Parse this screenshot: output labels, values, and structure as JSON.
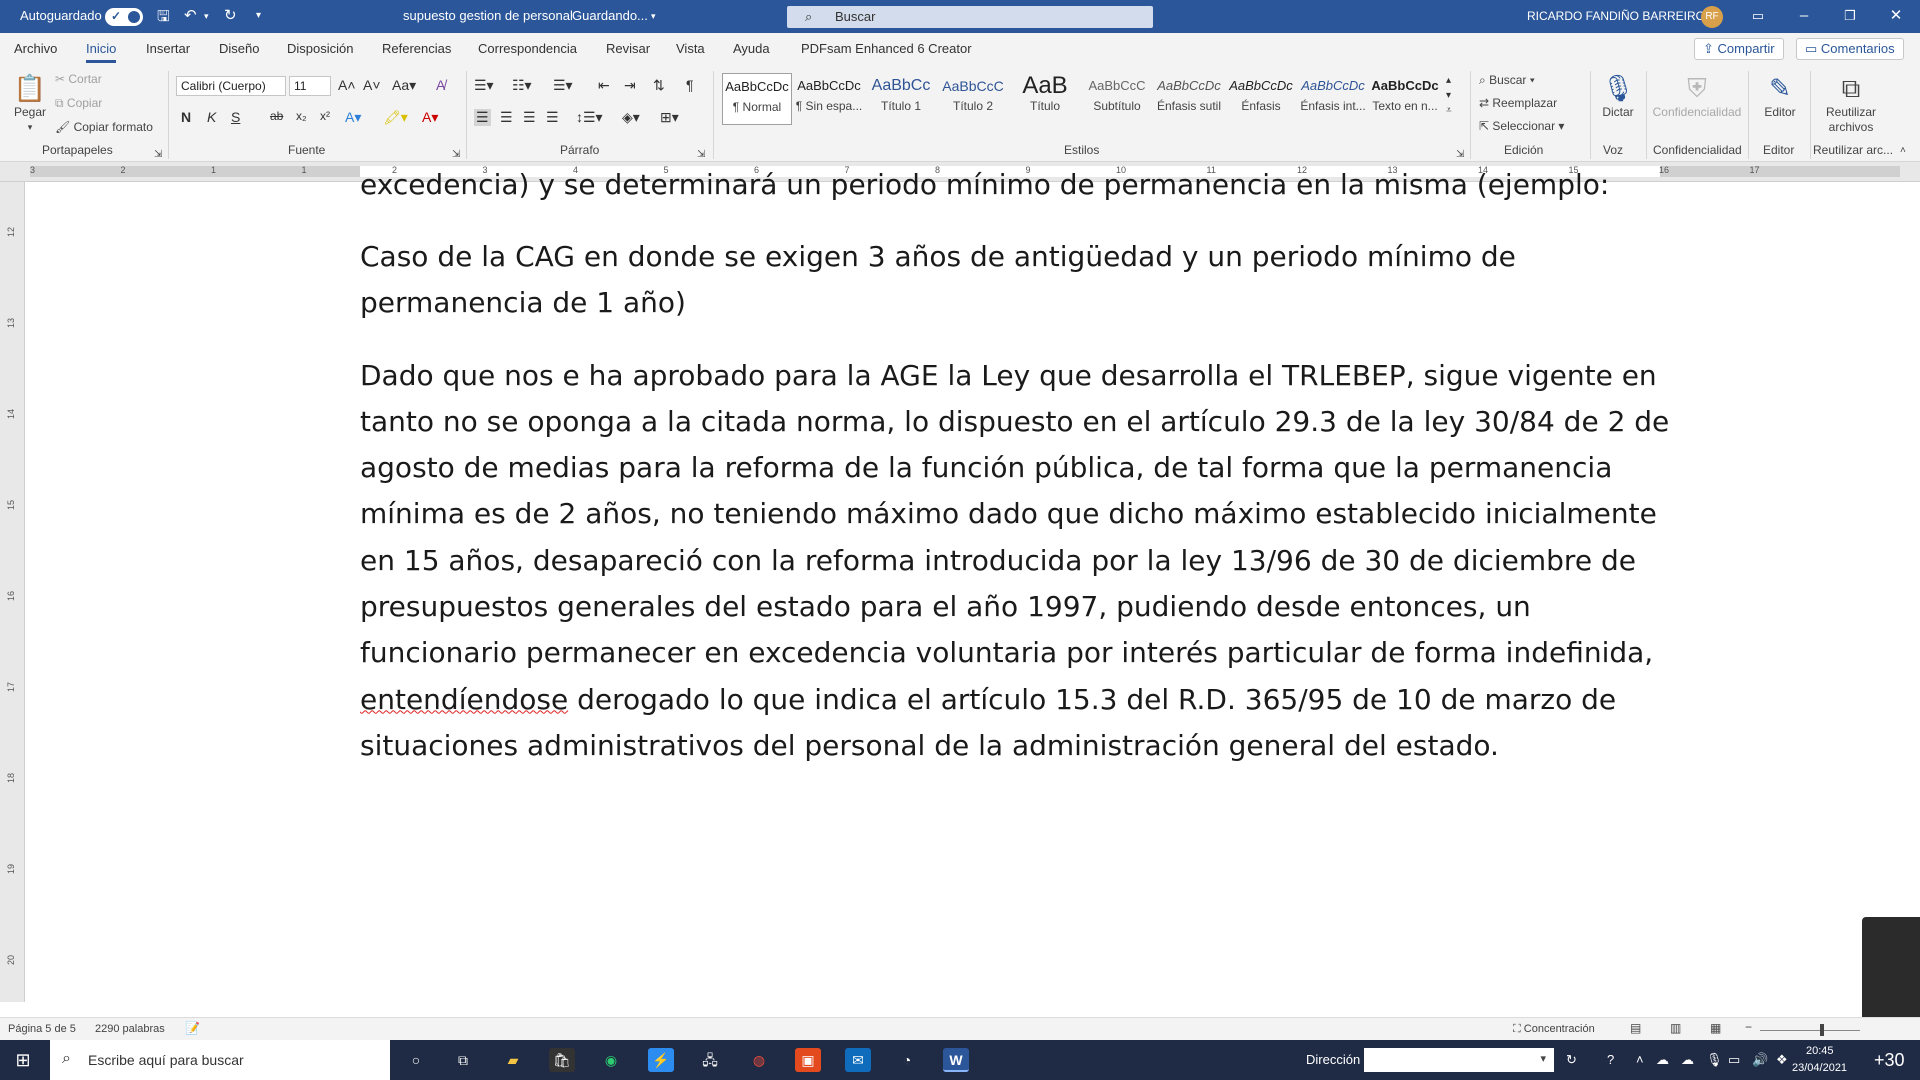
{
  "titlebar": {
    "autosave_label": "Autoguardado",
    "doc_title": "supuesto gestion de personal",
    "save_state": "Guardando...",
    "search_placeholder": "Buscar",
    "user_name": "RICARDO FANDIÑO BARREIRO",
    "user_initials": "RF"
  },
  "tabs": [
    "Archivo",
    "Inicio",
    "Insertar",
    "Diseño",
    "Disposición",
    "Referencias",
    "Correspondencia",
    "Revisar",
    "Vista",
    "Ayuda",
    "PDFsam Enhanced 6 Creator"
  ],
  "active_tab": "Inicio",
  "share_label": "Compartir",
  "comments_label": "Comentarios",
  "ribbon": {
    "clipboard": {
      "paste": "Pegar",
      "cut": "Cortar",
      "copy": "Copiar",
      "format_painter": "Copiar formato",
      "group": "Portapapeles"
    },
    "font": {
      "family": "Calibri (Cuerpo)",
      "size": "11",
      "group": "Fuente",
      "bold": "N",
      "italic": "K",
      "underline": "S"
    },
    "paragraph": {
      "group": "Párrafo"
    },
    "styles": {
      "group": "Estilos",
      "items": [
        {
          "preview": "AaBbCcDc",
          "label": "¶ Normal"
        },
        {
          "preview": "AaBbCcDc",
          "label": "¶ Sin espa..."
        },
        {
          "preview": "AaBbCc",
          "label": "Título 1"
        },
        {
          "preview": "AaBbCcC",
          "label": "Título 2"
        },
        {
          "preview": "AaB",
          "label": "Título"
        },
        {
          "preview": "AaBbCcC",
          "label": "Subtítulo"
        },
        {
          "preview": "AaBbCcDc",
          "label": "Énfasis sutil"
        },
        {
          "preview": "AaBbCcDc",
          "label": "Énfasis"
        },
        {
          "preview": "AaBbCcDc",
          "label": "Énfasis int..."
        },
        {
          "preview": "AaBbCcDc",
          "label": "Texto en n..."
        }
      ]
    },
    "editing": {
      "find": "Buscar",
      "replace": "Reemplazar",
      "select": "Seleccionar",
      "group": "Edición"
    },
    "voice": {
      "dictate": "Dictar",
      "group": "Voz"
    },
    "confidentiality": {
      "label": "Confidencialidad",
      "group": "Confidencialidad"
    },
    "editor": {
      "label": "Editor",
      "group": "Editor"
    },
    "reuse": {
      "label": "Reutilizar archivos",
      "group": "Reutilizar arc..."
    }
  },
  "ruler_numbers": [
    "3",
    "2",
    "1",
    "1",
    "2",
    "3",
    "4",
    "5",
    "6",
    "7",
    "8",
    "9",
    "10",
    "11",
    "12",
    "13",
    "14",
    "15",
    "16",
    "17"
  ],
  "vruler_numbers": [
    "12",
    "13",
    "14",
    "15",
    "16",
    "17",
    "18",
    "19",
    "20"
  ],
  "document": {
    "cut_line": "excedencia) y se determinará un periodo mínimo de permanencia en la misma (ejemplo:",
    "para1": "Caso de la CAG en donde se exigen 3 años de antigüedad y un periodo mínimo de permanencia de 1 año)",
    "para2_a": "Dado que nos e ha aprobado para la AGE la Ley que desarrolla el TRLEBEP, sigue vigente en tanto no se oponga a la citada norma, lo dispuesto en el artículo 29.3 de la ley 30/84 de 2 de agosto de medias para la reforma de la función pública, de tal forma que la permanencia mínima es de 2 años, no teniendo máximo dado que dicho máximo establecido inicialmente en 15 años, desapareció con la reforma introducida por la ley 13/96 de 30 de diciembre de presupuestos generales del estado para el año 1997, pudiendo desde entonces, un funcionario permanecer en excedencia voluntaria por interés particular de forma indefinida, ",
    "para2_spell": "entendíendose",
    "para2_b": " derogado lo que indica el artículo 15.3 del R.D. 365/95 de 10 de marzo de situaciones administrativos del personal de la administración general del estado."
  },
  "statusbar": {
    "page": "Página 5 de 5",
    "words": "2290 palabras",
    "focus": "Concentración"
  },
  "taskbar": {
    "search_placeholder": "Escribe aquí para buscar",
    "address_label": "Dirección",
    "time": "20:45",
    "date": "23/04/2021",
    "notif": "+30"
  }
}
